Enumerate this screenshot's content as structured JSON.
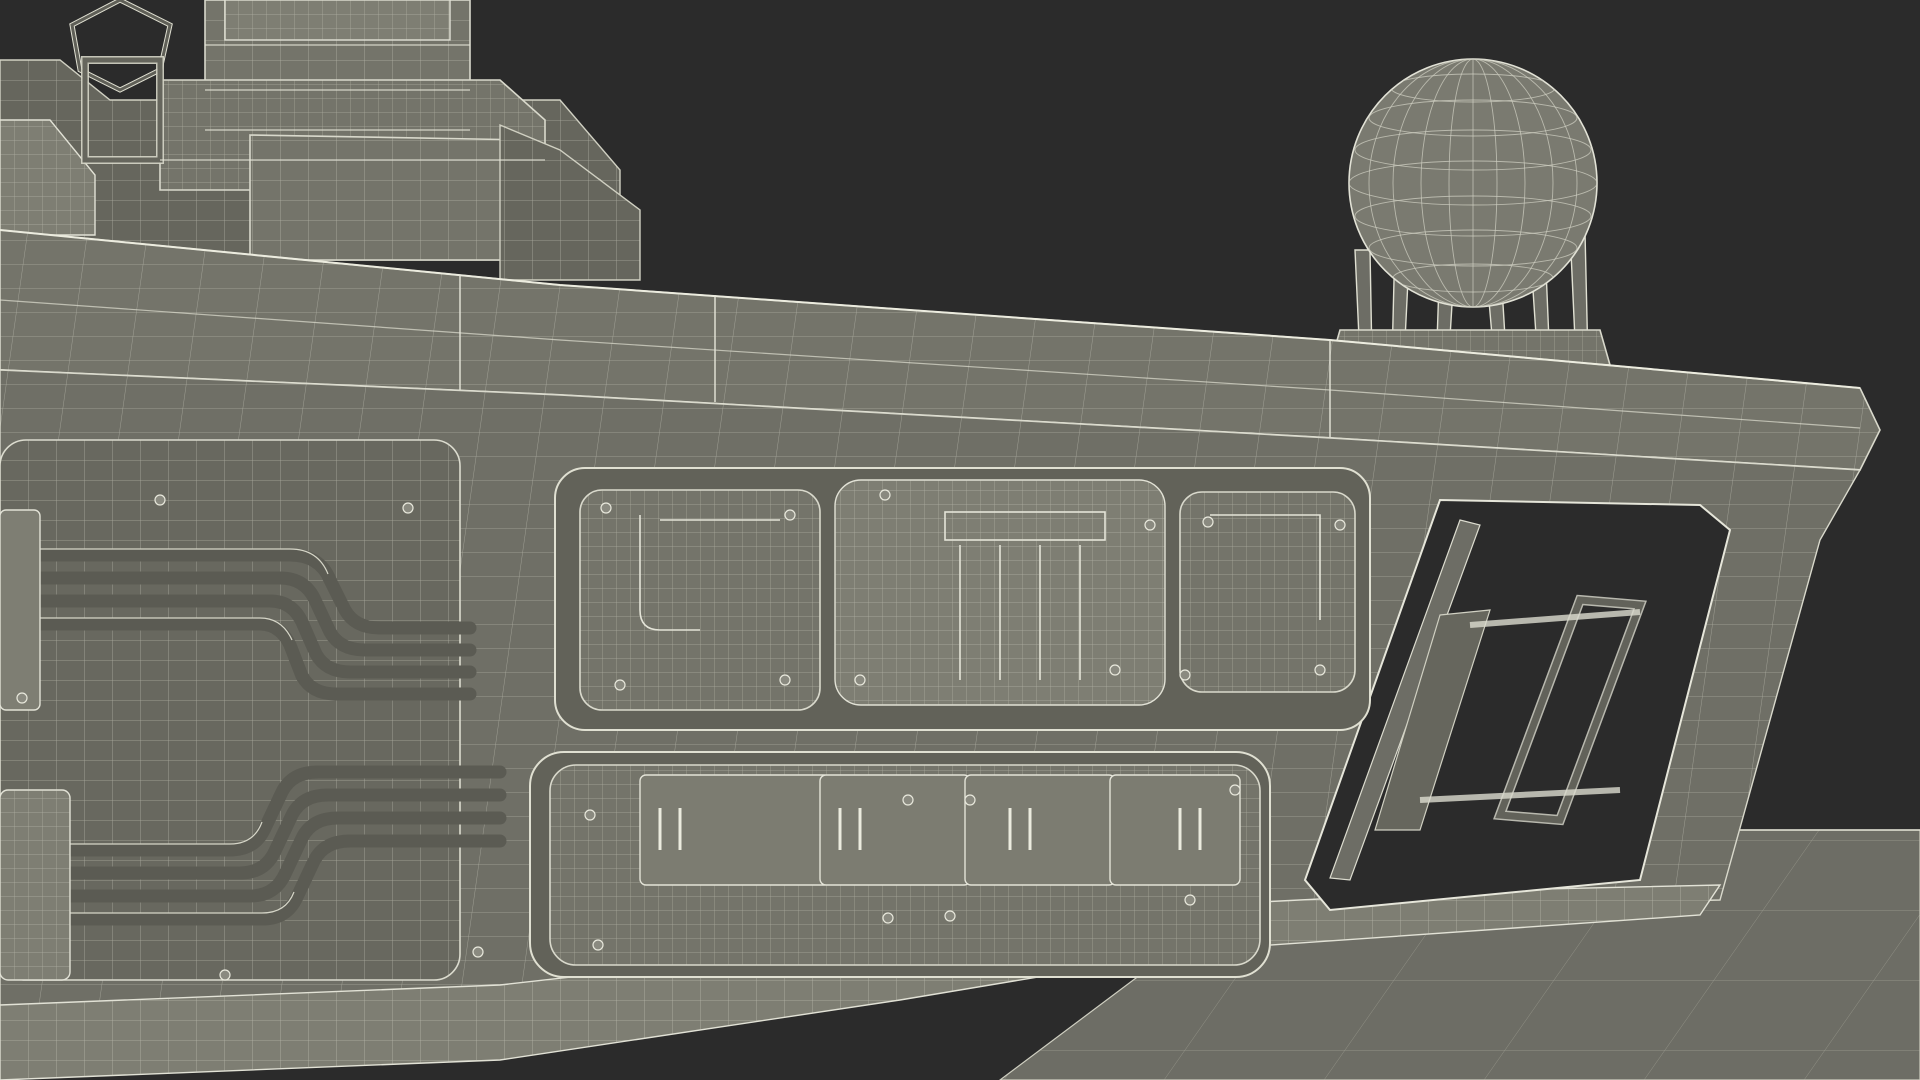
{
  "scene": {
    "subject": "",
    "colors": {
      "background": "#2b2b2b",
      "model_surface": "#74746a",
      "wireframe_lines": "#d9d9cc",
      "floor_plane": "#6d6d65"
    }
  }
}
